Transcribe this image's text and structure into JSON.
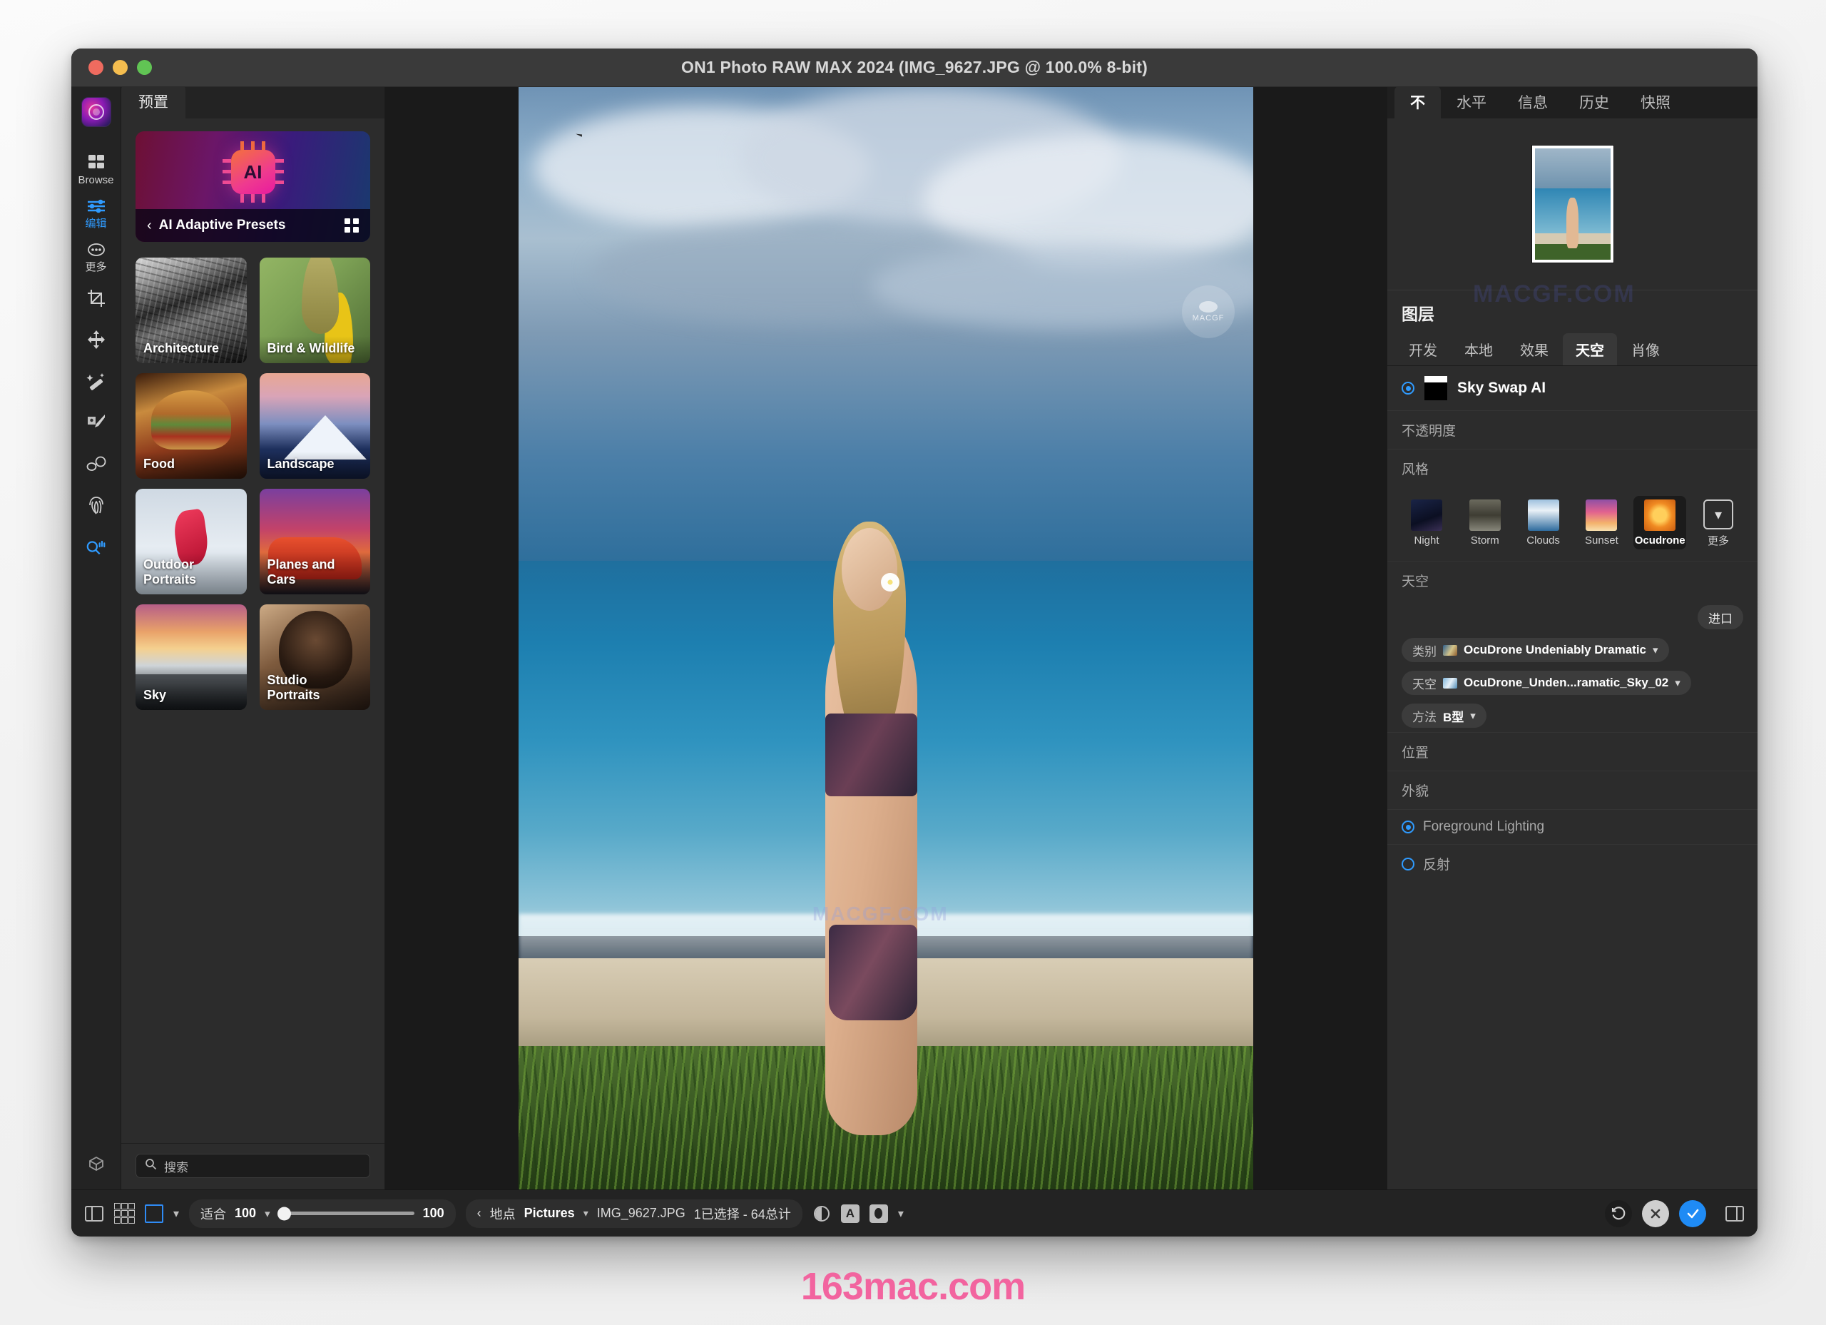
{
  "window": {
    "title": "ON1 Photo RAW MAX 2024 (IMG_9627.JPG @ 100.0% 8-bit)",
    "traffic": {
      "close": "close-button",
      "minimize": "minimize-button",
      "zoom": "zoom-button"
    }
  },
  "rail": {
    "app_icon": "on1-app-icon",
    "modules": [
      {
        "label": "Browse",
        "icon": "grid-icon",
        "active": false
      },
      {
        "label": "编辑",
        "icon": "sliders-icon",
        "active": true
      },
      {
        "label": "更多",
        "icon": "ellipsis-icon",
        "active": false
      }
    ],
    "tools": [
      {
        "name": "crop-tool",
        "icon": "crop-icon"
      },
      {
        "name": "move-tool",
        "icon": "move-arrows-icon"
      },
      {
        "name": "retouch-wand-tool",
        "icon": "magic-wand-icon"
      },
      {
        "name": "perfect-brush-tool",
        "icon": "paint-brush-icon"
      },
      {
        "name": "blemish-remover-tool",
        "icon": "glasses-icon"
      },
      {
        "name": "clone-stamp-tool",
        "icon": "fingerprint-icon"
      },
      {
        "name": "zoom-pan-tool",
        "icon": "magnifier-hand-icon",
        "active": true
      }
    ],
    "bottom_tool": {
      "name": "color-picker-tool",
      "icon": "eyedropper-cube-icon"
    }
  },
  "presets": {
    "tab_label": "预置",
    "hero": {
      "title": "AI Adaptive Presets",
      "back_icon": "chevron-left-icon",
      "grid_icon": "grid-view-icon",
      "chip_label": "AI"
    },
    "tiles": [
      {
        "label": "Architecture",
        "art": "art-arch"
      },
      {
        "label": "Bird & Wildlife",
        "art": "art-bird"
      },
      {
        "label": "Food",
        "art": "art-food"
      },
      {
        "label": "Landscape",
        "art": "art-land"
      },
      {
        "label": "Outdoor Portraits",
        "art": "art-outdoor"
      },
      {
        "label": "Planes and Cars",
        "art": "art-planes"
      },
      {
        "label": "Sky",
        "art": "art-sky"
      },
      {
        "label": "Studio Portraits",
        "art": "art-studio"
      }
    ],
    "search": {
      "placeholder": "搜索",
      "icon": "search-icon",
      "value": ""
    }
  },
  "right_panel": {
    "tabs": [
      {
        "label": "不",
        "active": true
      },
      {
        "label": "水平",
        "active": false
      },
      {
        "label": "信息",
        "active": false
      },
      {
        "label": "历史",
        "active": false
      },
      {
        "label": "快照",
        "active": false
      }
    ],
    "preview_name": "image-preview-thumbnail",
    "layers_title": "图层",
    "sub_tabs": [
      {
        "label": "开发",
        "active": false
      },
      {
        "label": "本地",
        "active": false
      },
      {
        "label": "效果",
        "active": false
      },
      {
        "label": "天空",
        "active": true
      },
      {
        "label": "肖像",
        "active": false
      }
    ],
    "layer": {
      "name": "Sky Swap AI",
      "enabled": true
    },
    "opacity_label": "不透明度",
    "style_label": "风格",
    "styles": [
      {
        "label": "Night",
        "cls": "st-night",
        "active": false
      },
      {
        "label": "Storm",
        "cls": "st-storm",
        "active": false
      },
      {
        "label": "Clouds",
        "cls": "st-clouds",
        "active": false
      },
      {
        "label": "Sunset",
        "cls": "st-sunset",
        "active": false
      },
      {
        "label": "Ocudrone",
        "cls": "st-ocu",
        "active": true
      }
    ],
    "styles_more_label": "更多",
    "sky_label": "天空",
    "import_label": "进口",
    "dropdowns": [
      {
        "key": "类别",
        "value": "OcuDrone Undeniably Dramatic",
        "swatch": "sw-cat"
      },
      {
        "key": "天空",
        "value": "OcuDrone_Unden...ramatic_Sky_02",
        "swatch": "sw-sky"
      },
      {
        "key": "方法",
        "value": "B型",
        "swatch": ""
      }
    ],
    "position_label": "位置",
    "appearance_label": "外貌",
    "foreground_lighting": {
      "label": "Foreground Lighting",
      "enabled": true
    },
    "reflection": {
      "label": "反射",
      "enabled": false
    }
  },
  "bottom_bar": {
    "panel_toggle_icon": "left-panel-toggle-icon",
    "grid_icon": "grid-view-icon",
    "single_icon": "single-view-icon",
    "view_chevron": "chevron-down-icon",
    "zoom": {
      "label": "适合",
      "value": "100",
      "chevron": "chevron-down-icon",
      "slider_value": "100"
    },
    "breadcrumb": {
      "back_icon": "chevron-left-icon",
      "location_label": "地点",
      "folder": "Pictures",
      "folder_chevron": "chevron-down-icon",
      "file": "IMG_9627.JPG",
      "count": "1已选择 - 64总计"
    },
    "view_icons": [
      {
        "name": "preview-toggle-icon",
        "glyph": "eye"
      },
      {
        "name": "soft-proof-icon",
        "glyph": "A"
      },
      {
        "name": "mask-view-icon",
        "glyph": "O"
      },
      {
        "name": "more-chevron-icon",
        "glyph": "chev"
      }
    ],
    "actions": [
      {
        "name": "reset-button",
        "glyph": "undo"
      },
      {
        "name": "cancel-button",
        "glyph": "x"
      },
      {
        "name": "apply-button",
        "glyph": "check"
      }
    ],
    "right_panel_toggle_icon": "right-panel-toggle-icon"
  },
  "watermarks": {
    "canvas_badge": "MACGF",
    "panel_text": "MACGF.COM",
    "footer": "163mac.com"
  },
  "colors": {
    "accent": "#2f9bff",
    "apply": "#1f8bf5",
    "window_bg": "#2c2c2c",
    "titlebar": "#3a3a3a",
    "watermark_pink": "#f2649f"
  }
}
